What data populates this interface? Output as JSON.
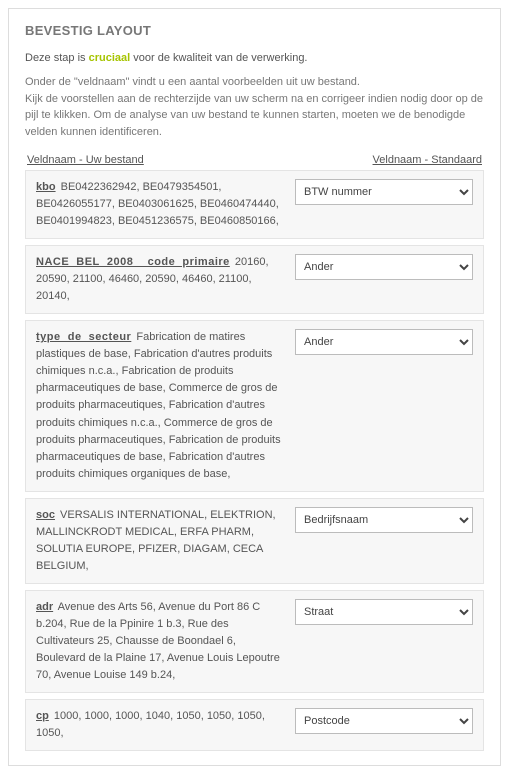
{
  "title": "BEVESTIG LAYOUT",
  "intro_pre": "Deze stap is ",
  "intro_crucial": "cruciaal",
  "intro_post": " voor de kwaliteit van de verwerking.",
  "instr_line1": "Onder de \"veldnaam\" vindt u een aantal voorbeelden uit uw bestand.",
  "instr_line2": "Kijk de voorstellen aan de rechterzijde van uw scherm na en corrigeer indien nodig door op de pijl te klikken. Om de analyse van uw bestand te kunnen starten, moeten we de benodigde velden kunnen identificeren.",
  "header_left": "Veldnaam - Uw bestand",
  "header_right": "Veldnaam - Standaard",
  "rows": [
    {
      "field": "kbo",
      "examples": " BE0422362942, BE0479354501, BE0426055177, BE0403061625, BE0460474440, BE0401994823, BE0451236575, BE0460850166,",
      "selected": "BTW nummer"
    },
    {
      "field": "NACE_BEL_2008__code_primaire",
      "examples": " 20160, 20590, 21100, 46460, 20590, 46460, 21100, 20140,",
      "selected": "Ander"
    },
    {
      "field": "type_de_secteur",
      "examples": " Fabrication de matires plastiques de base, Fabrication d'autres produits chimiques n.c.a., Fabrication de produits pharmaceutiques de base, Commerce de gros de produits pharmaceutiques, Fabrication d'autres produits chimiques n.c.a., Commerce de gros de produits pharmaceutiques, Fabrication de produits pharmaceutiques de base, Fabrication d'autres produits chimiques organiques de base,",
      "selected": "Ander"
    },
    {
      "field": "soc",
      "examples": " VERSALIS INTERNATIONAL, ELEKTRION, MALLINCKRODT MEDICAL, ERFA PHARM, SOLUTIA EUROPE, PFIZER, DIAGAM, CECA BELGIUM,",
      "selected": "Bedrijfsnaam"
    },
    {
      "field": "adr",
      "examples": " Avenue des Arts 56, Avenue du Port 86 C b.204, Rue de la Ppinire 1 b.3, Rue des Cultivateurs 25, Chausse de Boondael 6, Boulevard de la Plaine 17, Avenue Louis Lepoutre 70, Avenue Louise 149 b.24,",
      "selected": "Straat"
    },
    {
      "field": "cp",
      "examples": " 1000, 1000, 1000, 1040, 1050, 1050, 1050, 1050,",
      "selected": "Postcode"
    }
  ]
}
